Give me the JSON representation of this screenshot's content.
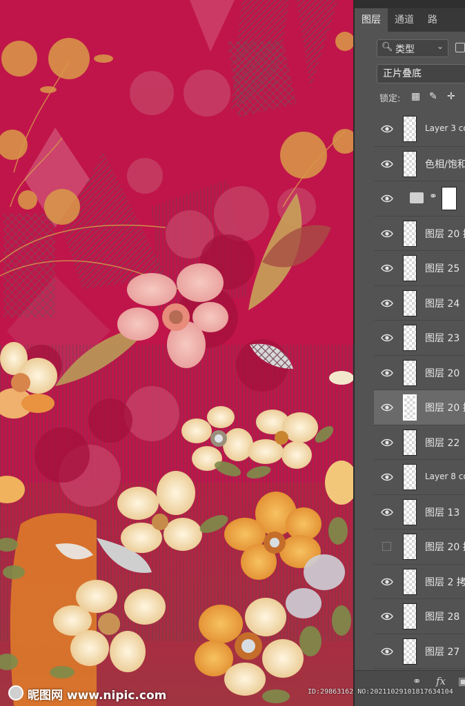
{
  "panel": {
    "tabs": [
      {
        "label": "图层",
        "active": true
      },
      {
        "label": "通道",
        "active": false
      },
      {
        "label": "路",
        "active": false
      }
    ],
    "filter": {
      "icon": "search-icon",
      "label": "类型"
    },
    "blend_mode": "正片叠底",
    "lock": {
      "label": "锁定:"
    },
    "layers": [
      {
        "name": "Layer 3 co",
        "visible": true,
        "selected": false
      },
      {
        "name": "色相/饱和",
        "visible": true,
        "selected": false
      },
      {
        "name": "",
        "visible": true,
        "selected": false,
        "adjustment_mask": true
      },
      {
        "name": "图层 20 拷",
        "visible": true,
        "selected": false
      },
      {
        "name": "图层 25",
        "visible": true,
        "selected": false
      },
      {
        "name": "图层 24",
        "visible": true,
        "selected": false
      },
      {
        "name": "图层 23",
        "visible": true,
        "selected": false
      },
      {
        "name": "图层 20",
        "visible": true,
        "selected": false
      },
      {
        "name": "图层 20 拷",
        "visible": true,
        "selected": true
      },
      {
        "name": "图层 22",
        "visible": true,
        "selected": false
      },
      {
        "name": "Layer 8 co",
        "visible": true,
        "selected": false
      },
      {
        "name": "图层 13",
        "visible": true,
        "selected": false
      },
      {
        "name": "图层 20 拷",
        "visible": false,
        "selected": false
      },
      {
        "name": "图层 2 拷",
        "visible": true,
        "selected": false
      },
      {
        "name": "图层 28",
        "visible": true,
        "selected": false
      },
      {
        "name": "图层 27",
        "visible": true,
        "selected": false
      }
    ],
    "bottom_icons": [
      "link-icon",
      "fx-icon",
      "mask-icon"
    ]
  },
  "watermark": {
    "site": "昵图网 www.nipic.com",
    "id_text": "ID:29863162 NO:20211029101817634104"
  },
  "colors": {
    "canvas_bg": "#c0154a",
    "panel_bg": "#535353",
    "panel_dark": "#383838"
  }
}
